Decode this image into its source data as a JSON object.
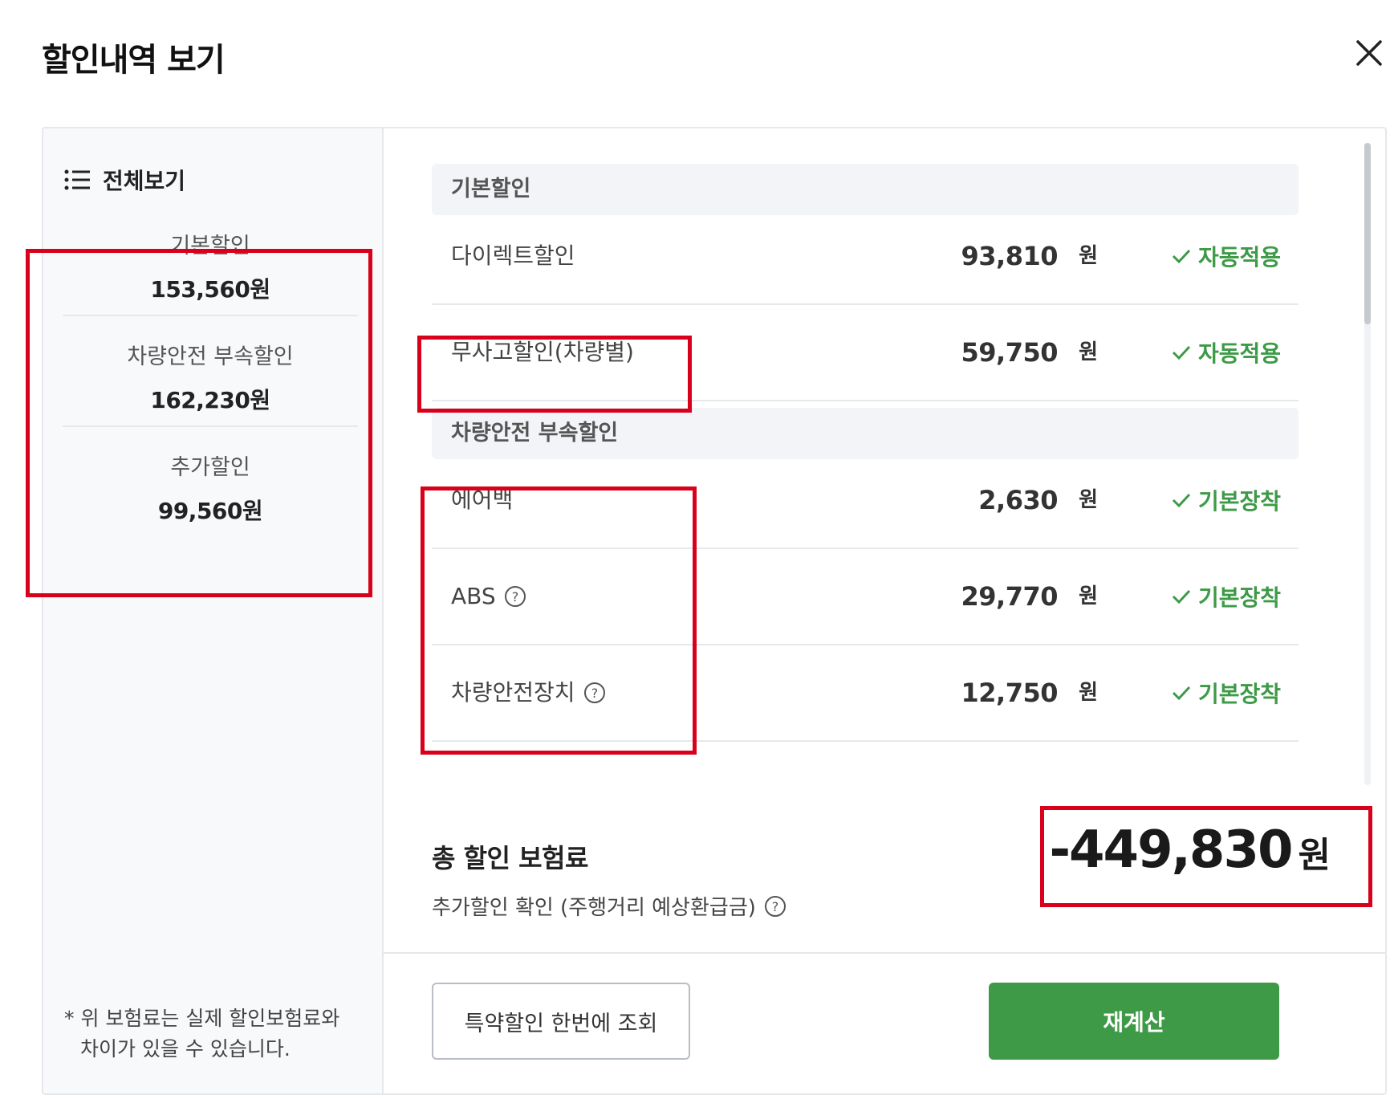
{
  "dialog": {
    "title": "할인내역 보기"
  },
  "sidebar": {
    "view_all_label": "전체보기",
    "summary": [
      {
        "label": "기본할인",
        "value": "153,560원"
      },
      {
        "label": "차량안전 부속할인",
        "value": "162,230원"
      },
      {
        "label": "추가할인",
        "value": "99,560원"
      }
    ],
    "note_line1": "* 위 보험료는 실제 할인보험료와",
    "note_line2": "차이가 있을 수 있습니다."
  },
  "main": {
    "sections": [
      {
        "title": "기본할인",
        "rows": [
          {
            "name": "다이렉트할인",
            "amount": "93,810",
            "unit": "원",
            "status": "자동적용"
          },
          {
            "name": "무사고할인(차량별)",
            "amount": "59,750",
            "unit": "원",
            "status": "자동적용"
          }
        ]
      },
      {
        "title": "차량안전 부속할인",
        "rows": [
          {
            "name": "에어백",
            "amount": "2,630",
            "unit": "원",
            "status": "기본장착"
          },
          {
            "name": "ABS",
            "amount": "29,770",
            "unit": "원",
            "status": "기본장착"
          },
          {
            "name": "차량안전장치",
            "amount": "12,750",
            "unit": "원",
            "status": "기본장착"
          }
        ]
      }
    ],
    "total_label": "총 할인 보험료",
    "extra_check_label": "추가할인 확인 (주행거리 예상환급금)",
    "total_value": "-449,830",
    "total_unit": "원"
  },
  "buttons": {
    "lookup_label": "특약할인 한번에 조회",
    "recalc_label": "재계산"
  },
  "colors": {
    "accent_green": "#3f9a47",
    "highlight_red": "#d9001b"
  }
}
